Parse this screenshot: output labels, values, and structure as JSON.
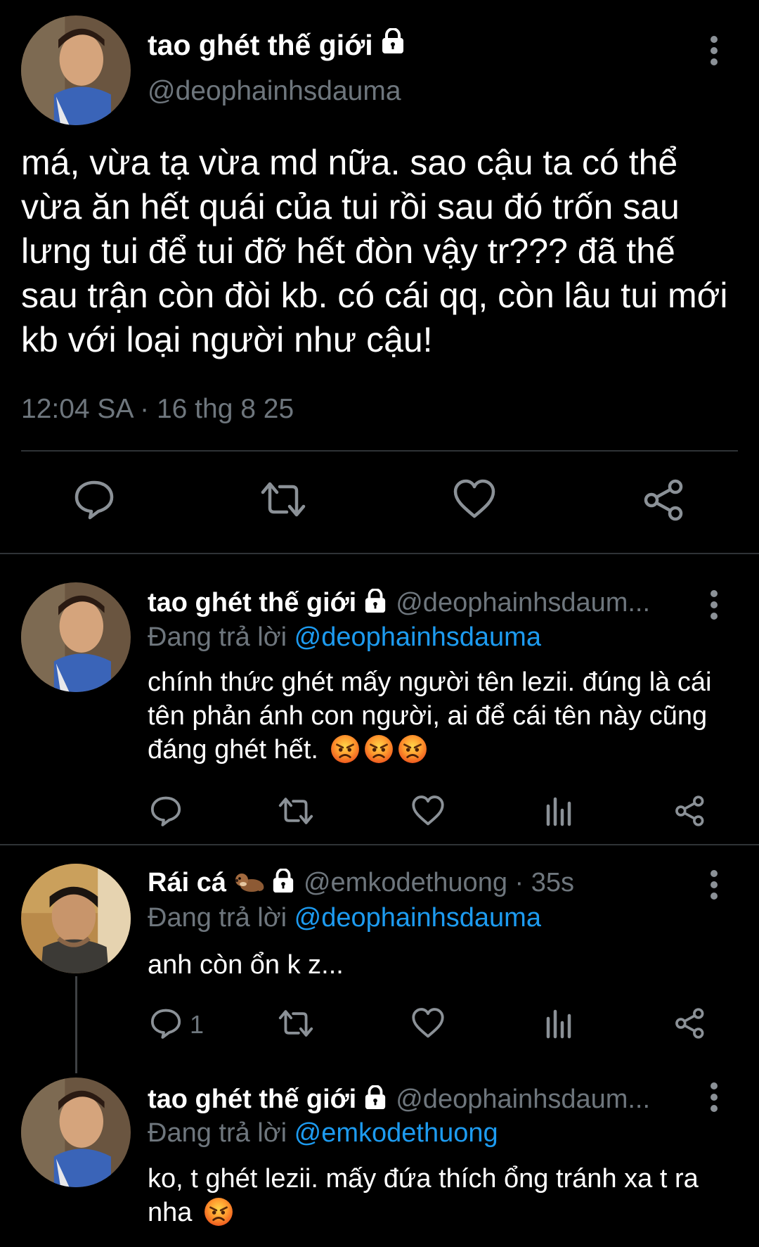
{
  "main_tweet": {
    "display_name": "tao ghét thế giới",
    "handle": "@deophainhsdauma",
    "text": "má, vừa tạ vừa md nữa. sao cậu ta có thể vừa ăn hết quái của tui rồi sau đó trốn sau lưng tui để tui đỡ hết đòn vậy tr??? đã thế sau trận còn đòi kb. có cái qq, còn lâu tui mới kb với loại người như cậu!",
    "timestamp": "12:04 SA · 16 thg 8 25",
    "icons": [
      "reply-icon",
      "retweet-icon",
      "like-icon",
      "share-icon"
    ]
  },
  "replies": [
    {
      "display_name": "tao ghét thế giới",
      "handle": "@deophainhsdaum...",
      "replying_label": "Đang trả lời ",
      "replying_to": "@deophainhsdauma",
      "text": "chính thức ghét mấy người tên lezii. đúng là cái tên phản ánh con người, ai để cái tên này cũng đáng ghét hết.",
      "emoji": [
        "angry-emoji",
        "angry-emoji",
        "angry-emoji"
      ]
    },
    {
      "display_name": "Rái cá",
      "name_emoji": "otter-emoji",
      "handle": "@emkodethuong · 35s",
      "replying_label": "Đang trả lời ",
      "replying_to": "@deophainhsdauma",
      "text": "anh còn ổn k z...",
      "reply_count": "1"
    },
    {
      "display_name": "tao ghét thế giới",
      "handle": "@deophainhsdaum...",
      "replying_label": "Đang trả lời ",
      "replying_to": "@emkodethuong",
      "text": "ko, t ghét lezii. mấy đứa thích ổng tránh xa t ra nha",
      "emoji": [
        "angry-emoji"
      ]
    }
  ],
  "colors": {
    "background": "#000000",
    "text": "#ffffff",
    "secondary": "#6e767d",
    "mention": "#1d9bf0",
    "divider": "#2f3336"
  }
}
